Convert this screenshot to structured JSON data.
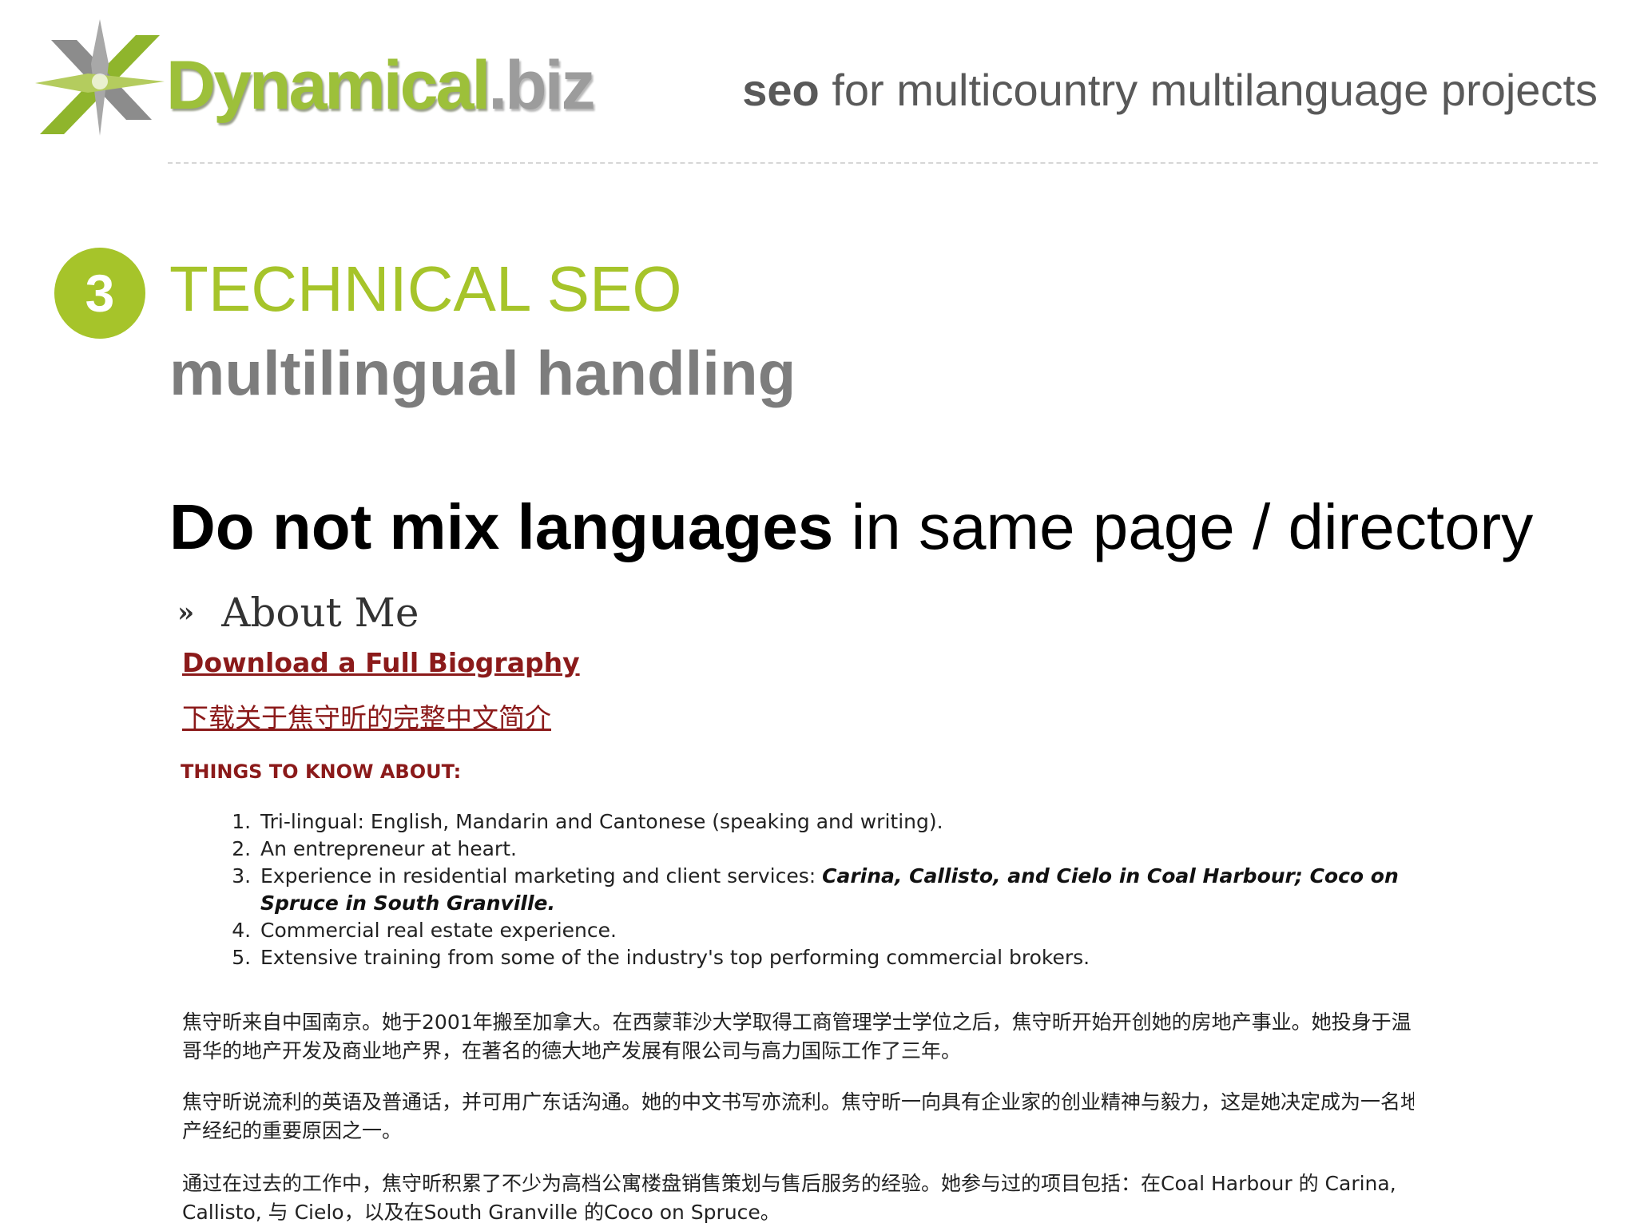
{
  "header": {
    "logo": {
      "brand_main": "Dynamical",
      "brand_suffix": ".biz",
      "mark_icon": "star-x-logo-icon",
      "colors": {
        "green": "#9dc03a",
        "gray": "#9c9c9c"
      }
    },
    "tagline_bold": "seo",
    "tagline_rest": " for multicountry multilanguage projects"
  },
  "section": {
    "number": "3",
    "title": "TECHNICAL SEO",
    "subtitle": "multilingual handling",
    "accent_color": "#a6c42a"
  },
  "headline": {
    "bold": "Do not mix languages",
    "rest": " in same page / directory"
  },
  "example": {
    "heading_icon": "double-chevron-right-icon",
    "heading": "About Me",
    "link_en": "Download a Full Biography",
    "link_cn": "下载关于焦守昕的完整中文简介",
    "things_heading": "THINGS TO KNOW ABOUT:",
    "items": [
      {
        "text": "Tri-lingual: English, Mandarin and Cantonese (speaking and writing).",
        "emphasis": ""
      },
      {
        "text": "An entrepreneur at heart.",
        "emphasis": ""
      },
      {
        "text": "Experience in residential marketing and client services: ",
        "emphasis": "Carina, Callisto, and Cielo in Coal Harbour; Coco on Spruce in South Granville."
      },
      {
        "text": "Commercial real estate experience.",
        "emphasis": ""
      },
      {
        "text": "Extensive training from some of the industry's top performing commercial brokers.",
        "emphasis": ""
      }
    ],
    "paragraphs_cn": [
      "焦守昕来自中国南京。她于2001年搬至加拿大。在西蒙菲沙大学取得工商管理学士学位之后，焦守昕开始开创她的房地产事业。她投身于温哥华的地产开发及商业地产界，在著名的德大地产发展有限公司与高力国际工作了三年。",
      "焦守昕说流利的英语及普通话，并可用广东话沟通。她的中文书写亦流利。焦守昕一向具有企业家的创业精神与毅力，这是她决定成为一名地产经纪的重要原因之一。",
      "通过在过去的工作中，焦守昕积累了不少为高档公寓楼盘销售策划与售后服务的经验。她参与过的项目包括：在Coal Harbour 的 Carina, Callisto, 与 Cielo，以及在South Granville 的Coco on Spruce。"
    ],
    "link_color": "#8b1a1a"
  }
}
